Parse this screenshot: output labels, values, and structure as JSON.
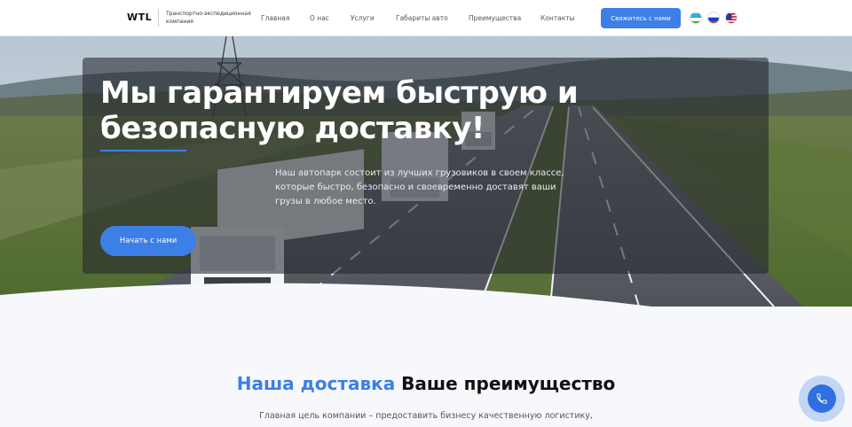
{
  "header": {
    "logo": "WTL",
    "logo_subtitle": "Транспортно-экспедиционная компания",
    "nav": [
      {
        "label": "Главная"
      },
      {
        "label": "О нас"
      },
      {
        "label": "Услуги"
      },
      {
        "label": "Габариты авто"
      },
      {
        "label": "Преимущества"
      },
      {
        "label": "Контакты"
      }
    ],
    "cta_label": "Свяжитесь с нами",
    "languages": [
      "uz",
      "ru",
      "en"
    ]
  },
  "hero": {
    "title": "Мы гарантируем быструю и безопасную доставку!",
    "text": "Наш автопарк состоит из лучших грузовиков в своем классе, которые быстро, безопасно и своевременно доставят ваши грузы в любое место.",
    "button_label": "Начать с нами"
  },
  "section": {
    "title_accent": "Наша доставка",
    "title_rest": "Ваше преимущество",
    "text": "Главная цель компании – предоставить бизнесу качественную логистику,"
  },
  "colors": {
    "accent": "#3d7fe6"
  },
  "icons": {
    "fab": "phone-icon"
  }
}
